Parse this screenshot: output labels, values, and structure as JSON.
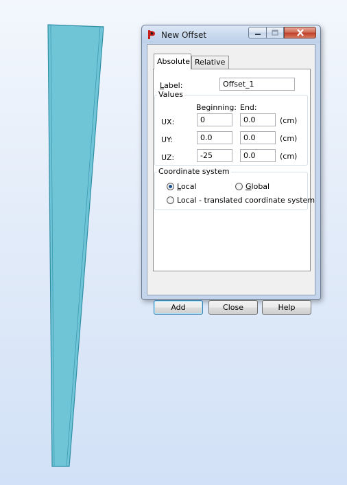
{
  "dialog": {
    "title": "New Offset",
    "tabs": [
      {
        "label": "Absolute",
        "active": true
      },
      {
        "label": "Relative",
        "active": false
      }
    ],
    "label_field": {
      "label": "Label:",
      "value": "Offset_1"
    },
    "values_group": {
      "title": "Values",
      "col_beginning": "Beginning:",
      "col_end": "End:",
      "unit": "(cm)",
      "rows": [
        {
          "name": "UX:",
          "beginning": "0",
          "end": "0.0"
        },
        {
          "name": "UY:",
          "beginning": "0.0",
          "end": "0.0"
        },
        {
          "name": "UZ:",
          "beginning": "-25",
          "end": "0.0"
        }
      ]
    },
    "coord_group": {
      "title": "Coordinate system",
      "options": [
        {
          "label": "Local",
          "checked": true
        },
        {
          "label": "Global",
          "checked": false
        },
        {
          "label": "Local - translated coordinate system",
          "checked": false
        }
      ]
    },
    "buttons": {
      "add": "Add",
      "close": "Close",
      "help": "Help"
    }
  },
  "colors": {
    "member_fill": "#6fc4d6",
    "member_edge": "#2f8ea6",
    "app_icon_red": "#c8201c"
  },
  "icons": {
    "app": "app-logo-icon",
    "minimize": "minimize-icon",
    "maximize": "maximize-icon",
    "close": "close-icon"
  }
}
